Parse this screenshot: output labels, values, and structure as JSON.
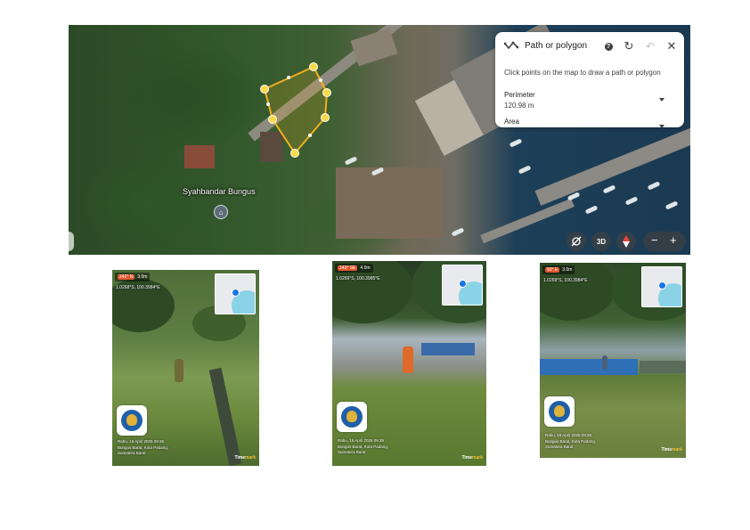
{
  "map": {
    "place_label": "Syahbandar Bungus",
    "panel": {
      "title": "Path or polygon",
      "instruction": "Click points on the map to draw a path or polygon",
      "perimeter_label": "Perimeter",
      "perimeter_value": "120.98 m",
      "area_label": "Area"
    },
    "controls": {
      "three_d_label": "3D",
      "zoom_out_label": "−",
      "zoom_in_label": "+"
    }
  },
  "photos": [
    {
      "heading": "242° N",
      "altitude": "3.0m",
      "coords": "1.0268°S, 100.3984°E",
      "caption_lines": [
        "Rabu, 16 April 2025 09:35",
        "Bungus Barat, Kota Padang,",
        "Sumatera Barat"
      ],
      "brand_a": "Time",
      "brand_b": "mark"
    },
    {
      "heading": "143° SE",
      "altitude": "4.0m",
      "coords": "1.0269°S, 100.3985°E",
      "caption_lines": [
        "Rabu, 16 April 2025 09:35",
        "Bungus Barat, Kota Padang,",
        "Sumatera Barat"
      ],
      "brand_a": "Time",
      "brand_b": "mark"
    },
    {
      "heading": "93° E",
      "altitude": "3.0m",
      "coords": "1.0269°S, 100.3984°E",
      "caption_lines": [
        "Rabu, 16 April 2025 09:35",
        "Bungus Barat, Kota Padang,",
        "Sumatera Barat"
      ],
      "brand_a": "Time",
      "brand_b": "mark"
    }
  ],
  "colors": {
    "polygon_stroke": "#f2b01e",
    "polygon_fill": "#f2b01e",
    "vertex": "#f9d84a"
  }
}
